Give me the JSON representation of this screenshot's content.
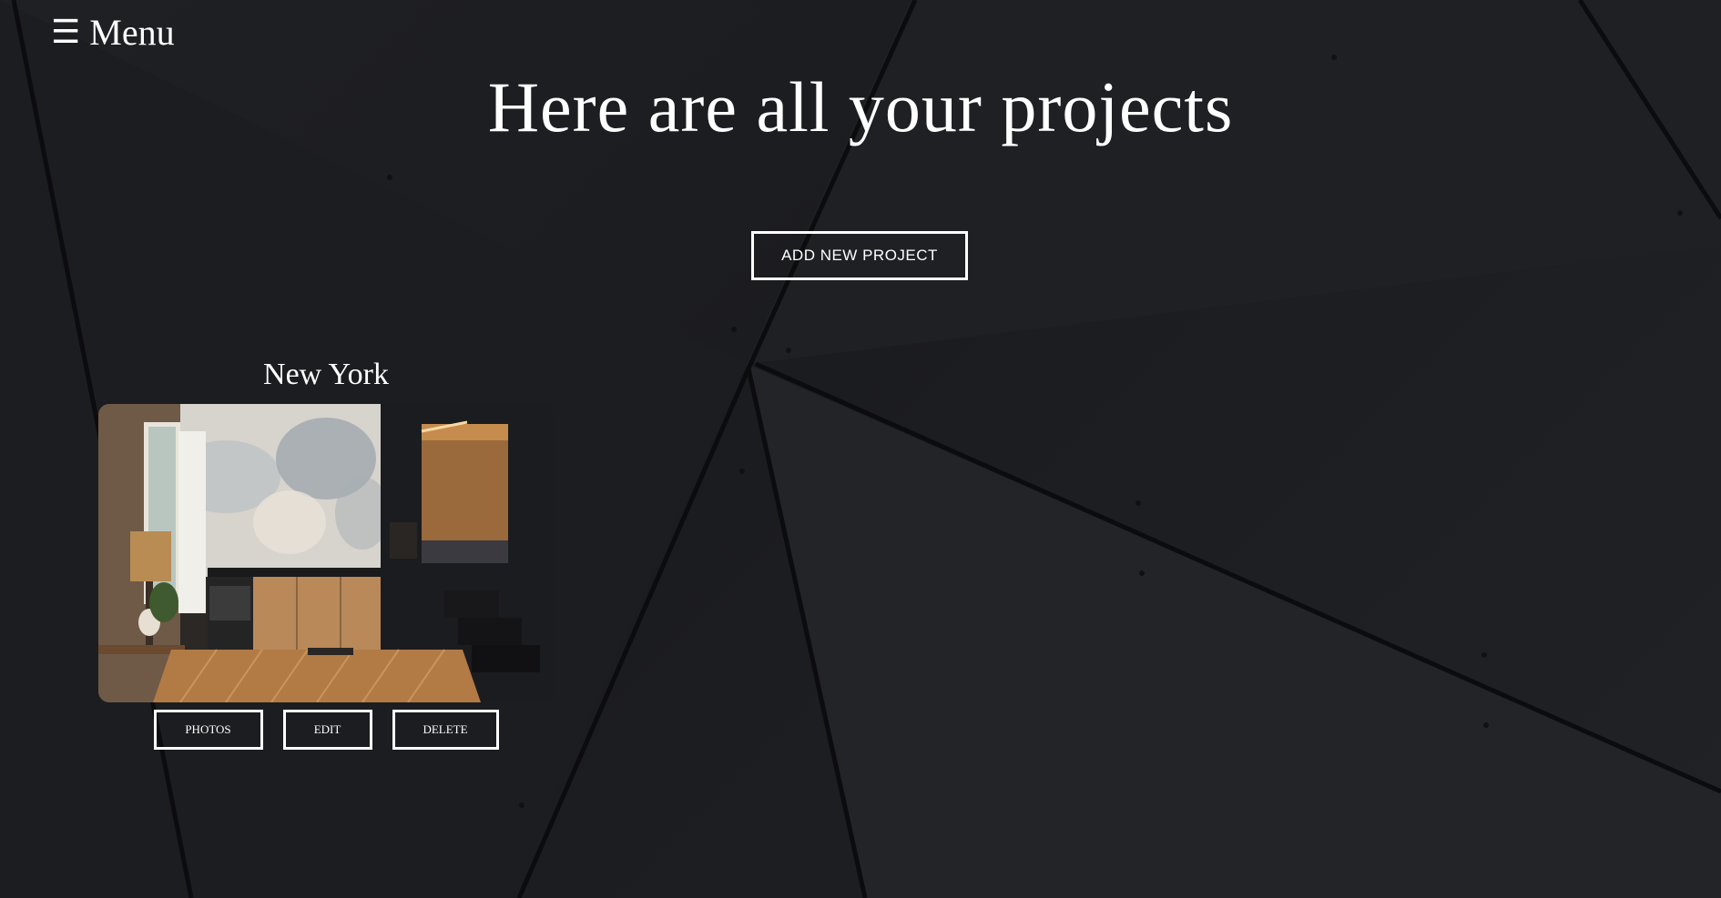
{
  "menu": {
    "icon": "hamburger-icon",
    "icon_glyph": "☰",
    "label": "Menu"
  },
  "page": {
    "title": "Here are all your projects"
  },
  "actions": {
    "add_project_label": "ADD NEW PROJECT"
  },
  "projects": [
    {
      "name": "New York",
      "image": "interior-kitchen-photo",
      "buttons": {
        "photos": "PHOTOS",
        "edit": "EDIT",
        "delete": "DELETE"
      }
    }
  ],
  "colors": {
    "background": "#1d1f22",
    "text": "#ffffff",
    "button_border": "#ffffff"
  }
}
